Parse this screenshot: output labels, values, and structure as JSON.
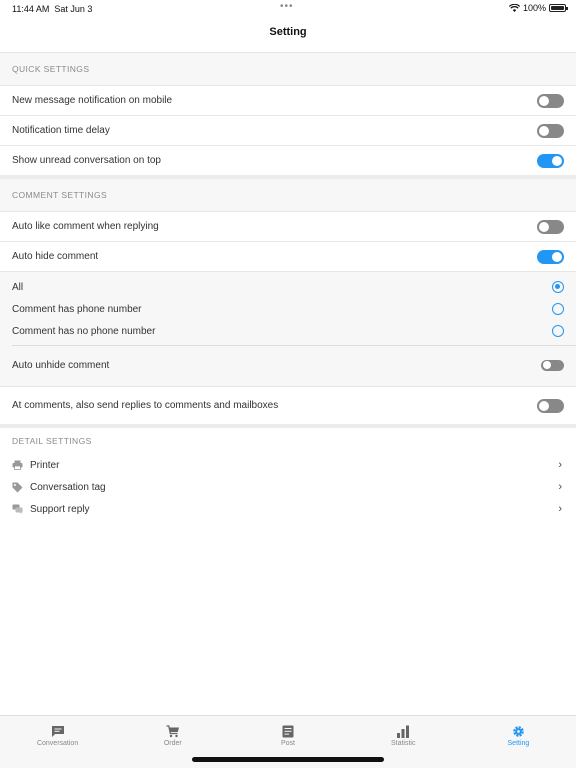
{
  "status": {
    "time": "11:44 AM",
    "date": "Sat Jun 3",
    "battery": "100%"
  },
  "nav": {
    "title": "Setting"
  },
  "quick_settings": {
    "header": "QUICK SETTINGS",
    "items": [
      {
        "label": "New message notification on mobile",
        "on": false
      },
      {
        "label": "Notification time delay",
        "on": false
      },
      {
        "label": "Show unread conversation on top",
        "on": true
      }
    ]
  },
  "comment_settings": {
    "header": "COMMENT SETTINGS",
    "auto_like": {
      "label": "Auto like comment when replying",
      "on": false
    },
    "auto_hide": {
      "label": "Auto hide comment",
      "on": true
    },
    "hide_options": [
      {
        "label": "All",
        "selected": true
      },
      {
        "label": "Comment has phone number",
        "selected": false
      },
      {
        "label": "Comment has no phone number",
        "selected": false
      }
    ],
    "auto_unhide": {
      "label": "Auto unhide comment",
      "on": false
    },
    "send_replies": {
      "label": "At comments, also send replies to comments and mailboxes",
      "on": false
    }
  },
  "detail_settings": {
    "header": "DETAIL SETTINGS",
    "items": [
      {
        "label": "Printer",
        "icon": "printer-icon"
      },
      {
        "label": "Conversation tag",
        "icon": "tag-icon"
      },
      {
        "label": "Support reply",
        "icon": "chat-bubbles-icon"
      }
    ]
  },
  "tabbar": {
    "tabs": [
      {
        "label": "Conversation",
        "icon": "message-icon",
        "active": false
      },
      {
        "label": "Order",
        "icon": "cart-icon",
        "active": false
      },
      {
        "label": "Post",
        "icon": "document-icon",
        "active": false
      },
      {
        "label": "Statistic",
        "icon": "bar-chart-icon",
        "active": false
      },
      {
        "label": "Setting",
        "icon": "gear-icon",
        "active": true
      }
    ]
  },
  "colors": {
    "accent": "#2196f3",
    "toggle_off": "#888888",
    "section_bg": "#f7f7f7"
  }
}
